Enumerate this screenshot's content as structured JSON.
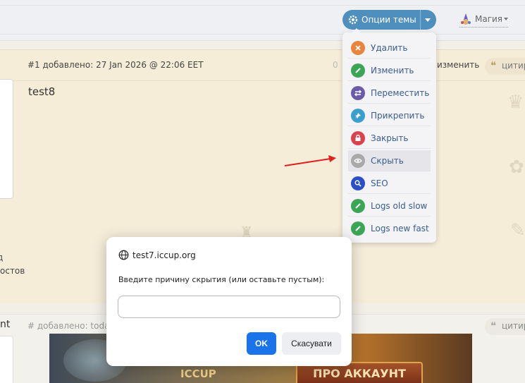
{
  "header": {
    "theme_options_label": "Опции темы",
    "user_name": "Магия"
  },
  "theme_menu": {
    "items": [
      {
        "label": "Удалить",
        "icon": "close-icon",
        "color": "#e8843c"
      },
      {
        "label": "Изменить",
        "icon": "pencil-icon",
        "color": "#3aa655"
      },
      {
        "label": "Переместить",
        "icon": "move-arrows-icon",
        "color": "#6b5aa8"
      },
      {
        "label": "Прикрепить",
        "icon": "pin-icon",
        "color": "#3a9fcf"
      },
      {
        "label": "Закрыть",
        "icon": "lock-icon",
        "color": "#d9434c"
      },
      {
        "label": "Скрыть",
        "icon": "eye-icon",
        "color": "#a8a8a8"
      },
      {
        "label": "SEO",
        "icon": "search-icon",
        "color": "#2b4fc7"
      },
      {
        "label": "Logs old slow",
        "icon": "pencil-icon",
        "color": "#3aa655"
      },
      {
        "label": "Logs new fast",
        "icon": "pencil-icon",
        "color": "#3aa655"
      }
    ]
  },
  "post1": {
    "info": "#1 добавлено: 27 Jan 2026 @ 22:06 EET",
    "counter": "0",
    "edit_label": "изменить",
    "quote_label": "цитир",
    "body": "test8",
    "side_line1": "д",
    "side_line2": "остов"
  },
  "post2": {
    "author": "nt",
    "info": "# добавлено: today",
    "quote_label": "цитир",
    "banner_logo": "ICCUP",
    "banner_button": "ПРО АККАУНТ"
  },
  "dialog": {
    "site": "test7.iccup.org",
    "prompt": "Введите причину скрытия (или оставьте пустым):",
    "input_value": "",
    "ok_label": "OK",
    "cancel_label": "Скасувати"
  }
}
